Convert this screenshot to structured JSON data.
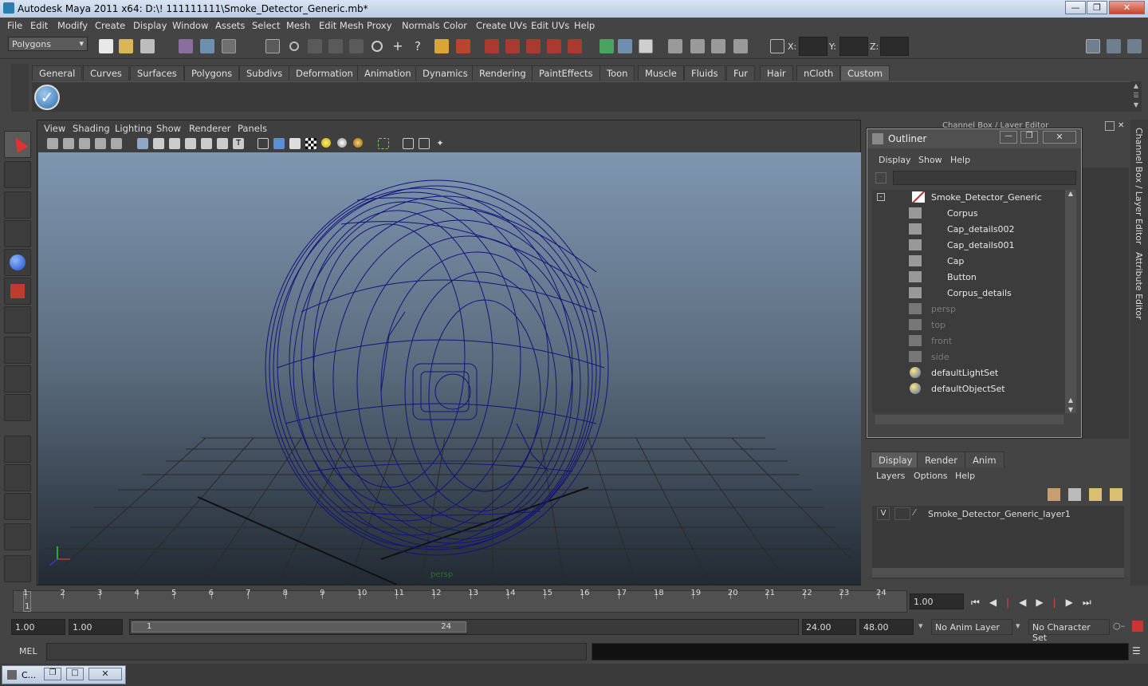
{
  "window": {
    "title": "Autodesk Maya 2011 x64: D:\\! 111111111\\Smoke_Detector_Generic.mb*"
  },
  "menubar": [
    "File",
    "Edit",
    "Modify",
    "Create",
    "Display",
    "Window",
    "Assets",
    "Select",
    "Mesh",
    "Edit Mesh",
    "Proxy",
    "Normals",
    "Color",
    "Create UVs",
    "Edit UVs",
    "Help"
  ],
  "statusline": {
    "mode": "Polygons",
    "x_label": "X:",
    "y_label": "Y:",
    "z_label": "Z:"
  },
  "shelf": {
    "tabs": [
      "General",
      "Curves",
      "Surfaces",
      "Polygons",
      "Subdivs",
      "Deformation",
      "Animation",
      "Dynamics",
      "Rendering",
      "PaintEffects",
      "Toon",
      "Muscle",
      "Fluids",
      "Fur",
      "Hair",
      "nCloth",
      "Custom"
    ],
    "active_tab": "Custom"
  },
  "viewport": {
    "menus": [
      "View",
      "Shading",
      "Lighting",
      "Show",
      "Renderer",
      "Panels"
    ],
    "camera_label": "persp"
  },
  "outliner": {
    "title": "Outliner",
    "menus": [
      "Display",
      "Show",
      "Help"
    ],
    "items": [
      {
        "label": "Smoke_Detector_Generic",
        "icon": "transform-icon",
        "dim": false
      },
      {
        "label": "Corpus",
        "icon": "mesh-icon",
        "dim": false
      },
      {
        "label": "Cap_details002",
        "icon": "mesh-icon",
        "dim": false
      },
      {
        "label": "Cap_details001",
        "icon": "mesh-icon",
        "dim": false
      },
      {
        "label": "Cap",
        "icon": "mesh-icon",
        "dim": false
      },
      {
        "label": "Button",
        "icon": "mesh-icon",
        "dim": false
      },
      {
        "label": "Corpus_details",
        "icon": "mesh-icon",
        "dim": false
      },
      {
        "label": "persp",
        "icon": "camera-icon",
        "dim": true
      },
      {
        "label": "top",
        "icon": "camera-icon",
        "dim": true
      },
      {
        "label": "front",
        "icon": "camera-icon",
        "dim": true
      },
      {
        "label": "side",
        "icon": "camera-icon",
        "dim": true
      },
      {
        "label": "defaultLightSet",
        "icon": "set-icon",
        "dim": false
      },
      {
        "label": "defaultObjectSet",
        "icon": "set-icon",
        "dim": false
      }
    ]
  },
  "channelbox": {
    "title": "Channel Box / Layer Editor"
  },
  "sidetabs": {
    "channel": "Channel Box / Layer Editor",
    "attribute": "Attribute Editor"
  },
  "layers": {
    "tabs": [
      "Display",
      "Render",
      "Anim"
    ],
    "active_tab": "Display",
    "menus": [
      "Layers",
      "Options",
      "Help"
    ],
    "rows": [
      {
        "visible": "V",
        "name": "Smoke_Detector_Generic_layer1"
      }
    ]
  },
  "timeline": {
    "ticks": [
      "1",
      "2",
      "3",
      "4",
      "5",
      "6",
      "7",
      "8",
      "9",
      "10",
      "11",
      "12",
      "13",
      "14",
      "15",
      "16",
      "17",
      "18",
      "19",
      "20",
      "21",
      "22",
      "23",
      "24"
    ],
    "current_frame_marker": "1",
    "current_time": "1.00"
  },
  "range": {
    "start_field": "1.00",
    "playback_start": "1.00",
    "slider_start": "1",
    "slider_end": "24",
    "playback_end": "24.00",
    "end_field": "48.00",
    "anim_layer": "No Anim Layer",
    "character_set": "No Character Set"
  },
  "mel": {
    "label": "MEL"
  },
  "taskbar": {
    "item_label": "C..."
  },
  "colors": {
    "wireframe": "#14147a",
    "grid": "#2a2a2a",
    "accent": "#6a9cc9"
  }
}
